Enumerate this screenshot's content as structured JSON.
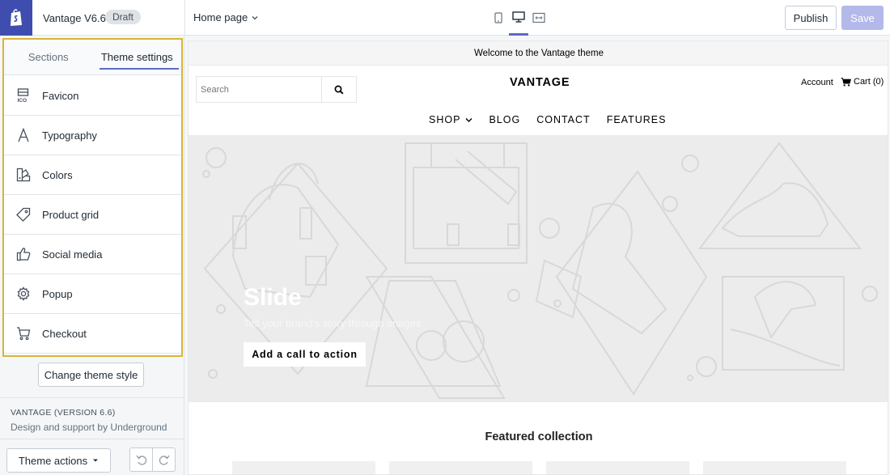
{
  "topbar": {
    "theme_name": "Vantage V6.6",
    "status_badge": "Draft",
    "page_selector": "Home page",
    "publish_label": "Publish",
    "save_label": "Save",
    "view_modes": [
      "mobile-icon",
      "desktop-icon",
      "fullwidth-icon"
    ],
    "active_view": "desktop-icon"
  },
  "sidebar": {
    "tabs": [
      {
        "label": "Sections"
      },
      {
        "label": "Theme settings"
      }
    ],
    "active_tab": "Theme settings",
    "items": [
      {
        "label": "Favicon",
        "icon": "favicon-icon"
      },
      {
        "label": "Typography",
        "icon": "typography-icon"
      },
      {
        "label": "Colors",
        "icon": "colors-icon"
      },
      {
        "label": "Product grid",
        "icon": "tag-icon"
      },
      {
        "label": "Social media",
        "icon": "thumbs-up-icon"
      },
      {
        "label": "Popup",
        "icon": "gear-icon"
      },
      {
        "label": "Checkout",
        "icon": "cart-icon"
      }
    ],
    "change_style_label": "Change theme style",
    "version_text": "VANTAGE (VERSION 6.6)",
    "support_text": "Design and support by Underground",
    "theme_actions_label": "Theme actions"
  },
  "preview": {
    "announcement": "Welcome to the Vantage theme",
    "search_placeholder": "Search",
    "brand": "VANTAGE",
    "account": "Account",
    "cart": "Cart (0)",
    "nav": [
      "SHOP",
      "BLOG",
      "CONTACT",
      "FEATURES"
    ],
    "slide_title": "Slide",
    "slide_subtitle": "Tell your brand's story through images",
    "cta_label": "Add a call to action",
    "featured_title": "Featured collection"
  },
  "colors": {
    "accent": "#5c6ac4",
    "logo_bg": "#3f4eae",
    "highlight_border": "#d9b43c",
    "save_disabled": "#b3b9e9"
  }
}
